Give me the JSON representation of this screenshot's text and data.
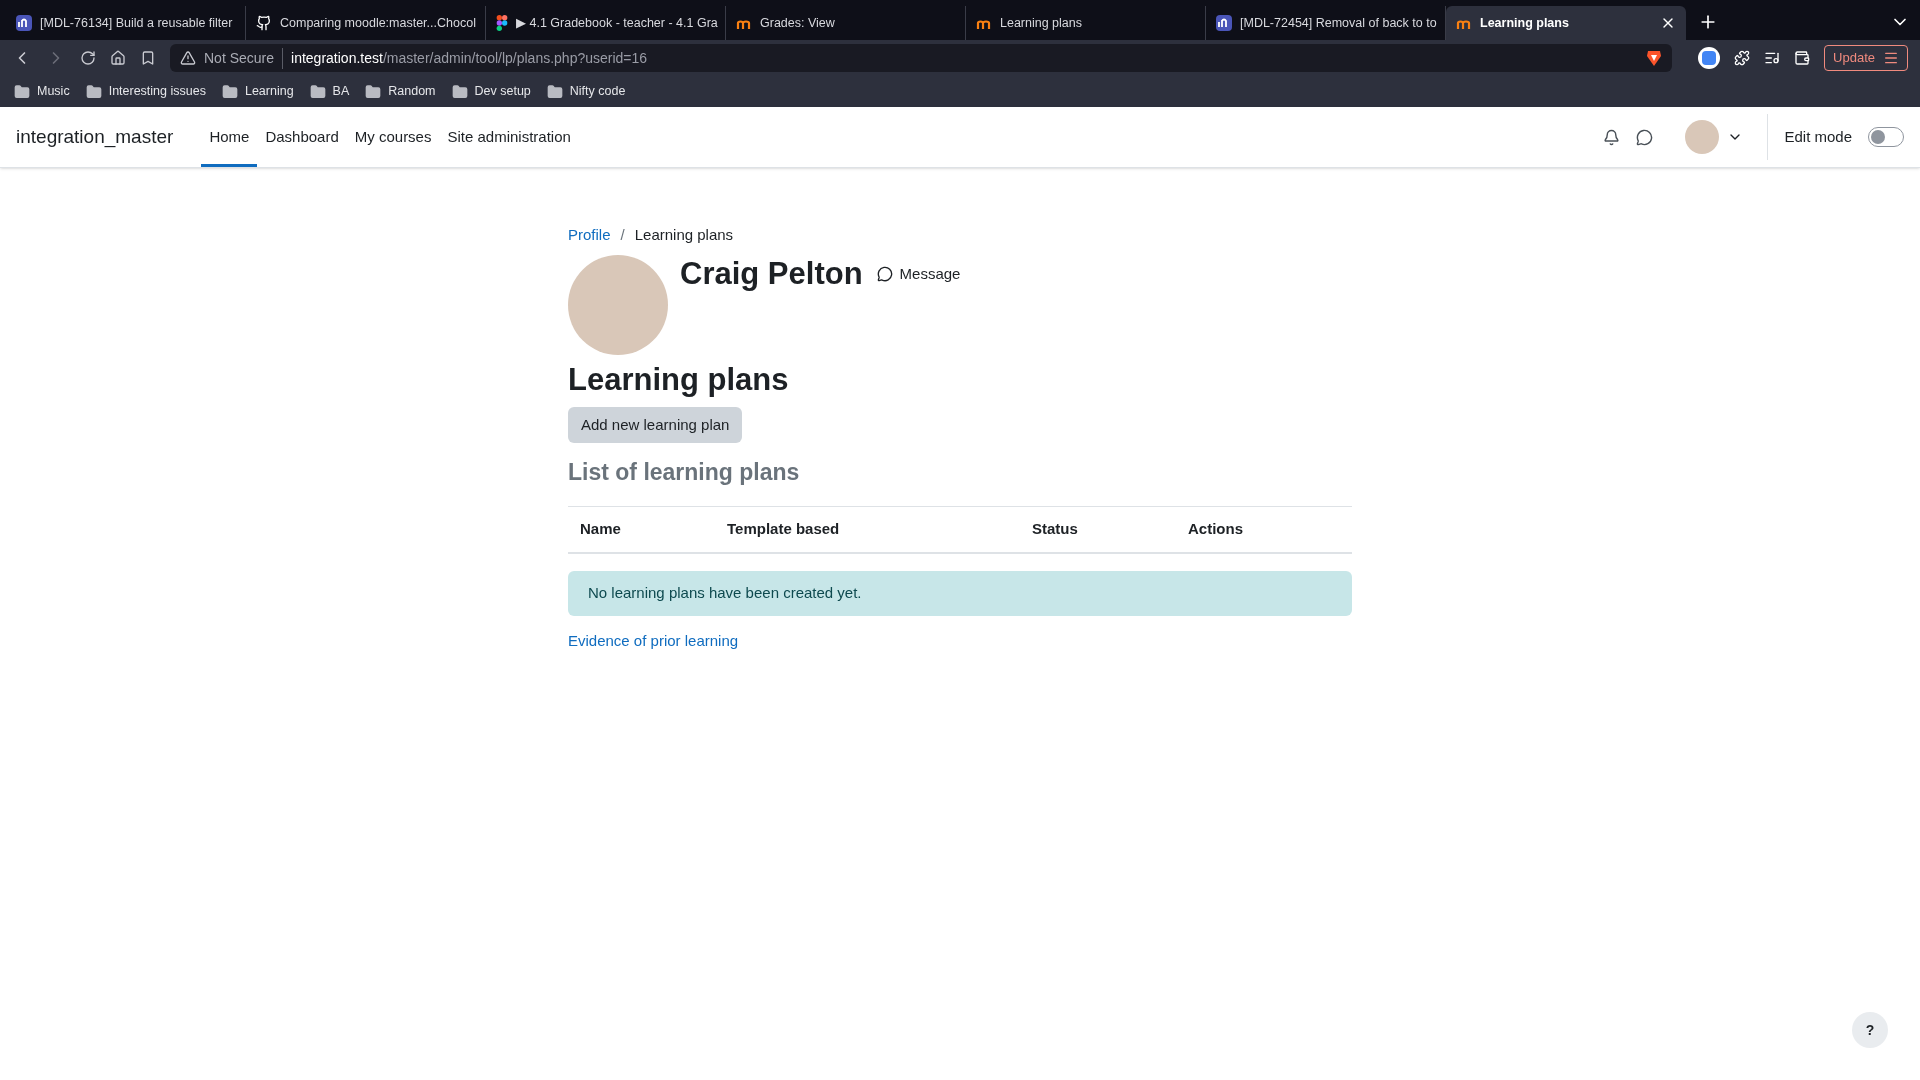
{
  "browser": {
    "tabs": [
      {
        "label": "[MDL-76134] Build a reusable filter",
        "kind": "tracker",
        "selected": false
      },
      {
        "label": "Comparing moodle:master...Chocol",
        "kind": "github",
        "selected": false
      },
      {
        "label": "▶ 4.1 Gradebook - teacher - 4.1 Gra",
        "kind": "figma",
        "selected": false
      },
      {
        "label": "Grades: View",
        "kind": "moodle",
        "selected": false
      },
      {
        "label": "Learning plans",
        "kind": "moodle",
        "selected": false
      },
      {
        "label": "[MDL-72454] Removal of back to to",
        "kind": "tracker",
        "selected": false
      },
      {
        "label": "Learning plans",
        "kind": "moodle",
        "selected": true
      }
    ],
    "security": "Not Secure",
    "url_host": "integration.test",
    "url_path": "/master/admin/tool/lp/plans.php?userid=16",
    "update_button": "Update",
    "bookmarks": [
      "Music",
      "Interesting issues",
      "Learning",
      "BA",
      "Random",
      "Dev setup",
      "Nifty code"
    ]
  },
  "navbar": {
    "site_name": "integration_master",
    "items": [
      {
        "label": "Home",
        "selected": true
      },
      {
        "label": "Dashboard",
        "selected": false
      },
      {
        "label": "My courses",
        "selected": false
      },
      {
        "label": "Site administration",
        "selected": false
      }
    ],
    "edit_mode": {
      "label": "Edit mode",
      "on": false
    }
  },
  "breadcrumb": [
    {
      "label": "Profile",
      "kind": "link"
    },
    {
      "label": "/",
      "kind": "separator"
    },
    {
      "label": "Learning plans",
      "kind": "current"
    }
  ],
  "user": {
    "name": "Craig Pelton",
    "message": "Message"
  },
  "heading": "Learning plans",
  "add_button": "Add new learning plan",
  "list_heading": "List of learning plans",
  "table": {
    "columns": [
      "Name",
      "Template based",
      "Status",
      "Actions"
    ]
  },
  "notice": "No learning plans have been created yet.",
  "evidence_link": "Evidence of prior learning",
  "help_button": "?"
}
